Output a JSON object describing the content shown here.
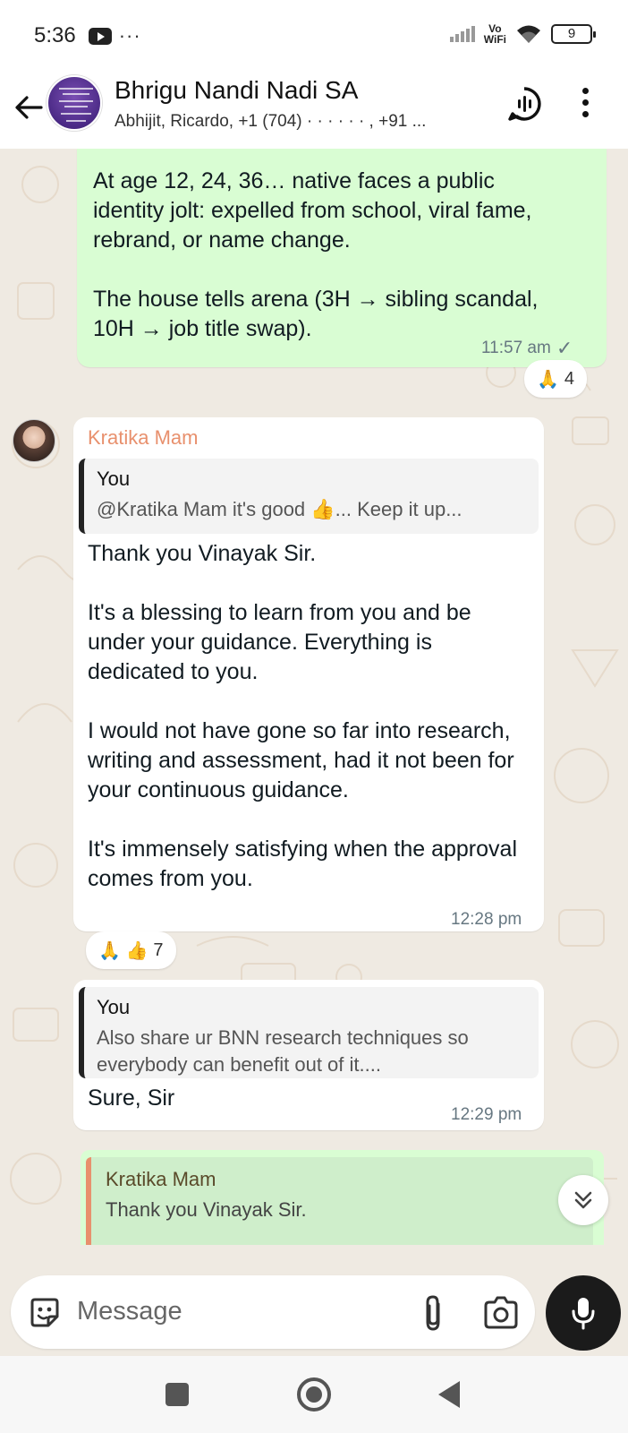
{
  "status_bar": {
    "time": "5:36",
    "dots": "···",
    "network_label_top": "Vo",
    "network_label_bottom": "WiFi",
    "battery": "9"
  },
  "header": {
    "title": "Bhrigu Nandi Nadi SA",
    "subtitle": "Abhijit, Ricardo, +1 (704) ·   ·   ·   ·  ·  ·  , +91 ..."
  },
  "messages": [
    {
      "id": "m1",
      "direction": "outgoing",
      "text": "At age 12, 24, 36… native faces a public identity jolt: expelled from school, viral fame, rebrand, or name change.\n\nThe house tells arena (3H → sibling scandal, 10H → job title swap).",
      "time": "11:57 am",
      "status": "✓",
      "reaction": {
        "emojis": "🙏",
        "count": "4"
      }
    },
    {
      "id": "m2",
      "direction": "incoming",
      "sender": "Kratika Mam",
      "quote": {
        "author": "You",
        "text": "@Kratika Mam it's good 👍... Keep it up..."
      },
      "text": "Thank you Vinayak Sir.\n\nIt's a blessing to learn from you and be under your guidance. Everything is dedicated to you.\n\nI would not have gone so far into research, writing and assessment, had it  not been for your continuous guidance.\n\nIt's immensely satisfying when the approval comes from you.",
      "time": "12:28 pm",
      "reaction": {
        "emojis": "🙏 👍",
        "count": "7"
      }
    },
    {
      "id": "m3",
      "direction": "incoming",
      "quote": {
        "author": "You",
        "text": "Also share ur BNN research techniques so everybody can benefit out of it...."
      },
      "text": "Sure, Sir",
      "time": "12:29 pm"
    }
  ],
  "reply_preview": {
    "author": "Kratika Mam",
    "text": "Thank you Vinayak Sir."
  },
  "composer": {
    "placeholder": "Message"
  },
  "colors": {
    "outgoing_bubble": "#d9fdd3",
    "incoming_bubble": "#ffffff",
    "chat_background": "#efeae2",
    "sender_name": "#e8906d",
    "mic_button": "#1b1b1b"
  },
  "icons": [
    "back-arrow-icon",
    "voice-chat-icon",
    "more-vert-icon",
    "chevron-double-down-icon",
    "sticker-emoji-icon",
    "paperclip-icon",
    "camera-icon",
    "microphone-icon"
  ]
}
